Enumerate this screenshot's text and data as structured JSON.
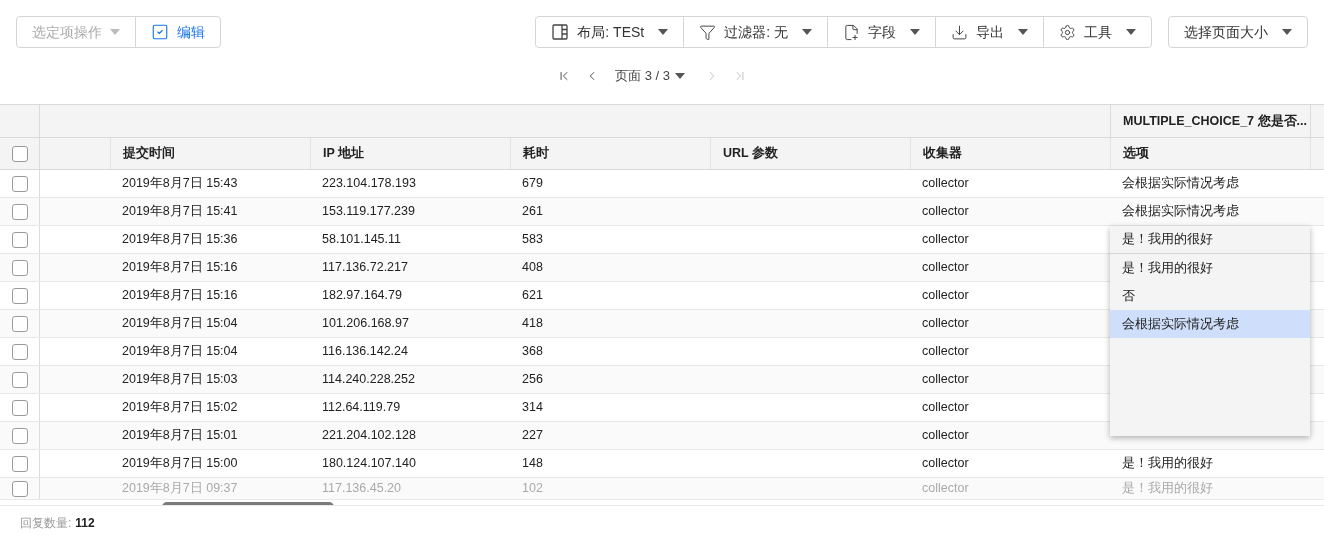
{
  "toolbar": {
    "left": [
      {
        "kind": "actions",
        "label": "选定项操作",
        "disabled": true
      },
      {
        "kind": "edit",
        "label": "编辑",
        "disabled": false
      }
    ],
    "right": [
      {
        "kind": "layout",
        "label": "布局: TESt"
      },
      {
        "kind": "filter",
        "label": "过滤器: 无"
      },
      {
        "kind": "field",
        "label": "字段"
      },
      {
        "kind": "export",
        "label": "导出"
      },
      {
        "kind": "tools",
        "label": "工具"
      }
    ],
    "page_size": {
      "label": "选择页面大小"
    }
  },
  "pagination": {
    "label": "页面 3 / 3",
    "buttons": [
      {
        "kind": "first",
        "disabled": false
      },
      {
        "kind": "prev",
        "disabled": false
      },
      {
        "kind": "next",
        "disabled": true
      },
      {
        "kind": "last",
        "disabled": true
      }
    ]
  },
  "table": {
    "select_all": {
      "checked": false
    },
    "group_header": "MULTIPLE_CHOICE_7 您是否...",
    "columns": [
      "提交时间",
      "IP 地址",
      "耗时",
      "URL 参数",
      "收集器",
      "选项"
    ],
    "rows": [
      {
        "checked": false,
        "dimmed": false,
        "time": "2019年8月7日 15:43",
        "ip": "223.104.178.193",
        "duration": "679",
        "collector": "collector",
        "choice": "会根据实际情况考虑"
      },
      {
        "checked": false,
        "dimmed": false,
        "time": "2019年8月7日 15:41",
        "ip": "153.119.177.239",
        "duration": "261",
        "collector": "collector",
        "choice": "会根据实际情况考虑"
      },
      {
        "checked": false,
        "dimmed": false,
        "time": "2019年8月7日 15:36",
        "ip": "58.101.145.11",
        "duration": "583",
        "collector": "collector"
      },
      {
        "checked": false,
        "dimmed": false,
        "time": "2019年8月7日 15:16",
        "ip": "117.136.72.217",
        "duration": "408",
        "collector": "collector"
      },
      {
        "checked": false,
        "dimmed": false,
        "time": "2019年8月7日 15:16",
        "ip": "182.97.164.79",
        "duration": "621",
        "collector": "collector"
      },
      {
        "checked": false,
        "dimmed": false,
        "time": "2019年8月7日 15:04",
        "ip": "101.206.168.97",
        "duration": "418",
        "collector": "collector"
      },
      {
        "checked": false,
        "dimmed": false,
        "time": "2019年8月7日 15:04",
        "ip": "116.136.142.24",
        "duration": "368",
        "collector": "collector"
      },
      {
        "checked": false,
        "dimmed": false,
        "time": "2019年8月7日 15:03",
        "ip": "114.240.228.252",
        "duration": "256",
        "collector": "collector"
      },
      {
        "checked": false,
        "dimmed": false,
        "time": "2019年8月7日 15:02",
        "ip": "112.64.119.79",
        "duration": "314",
        "collector": "collector"
      },
      {
        "checked": false,
        "dimmed": false,
        "time": "2019年8月7日 15:01",
        "ip": "221.204.102.128",
        "duration": "227",
        "collector": "collector"
      },
      {
        "checked": false,
        "dimmed": false,
        "time": "2019年8月7日 15:00",
        "ip": "180.124.107.140",
        "duration": "148",
        "collector": "collector",
        "choice": "是！我用的很好"
      },
      {
        "checked": false,
        "dimmed": true,
        "time": "2019年8月7日 09:37",
        "ip": "117.136.45.20",
        "duration": "102",
        "collector": "collector",
        "choice": "是！我用的很好"
      }
    ]
  },
  "dropdown": {
    "value": "是！我用的很好",
    "options": [
      {
        "label": "是！我用的很好",
        "highlighted": false
      },
      {
        "label": "否",
        "highlighted": false
      },
      {
        "label": "会根据实际情况考虑",
        "highlighted": true
      }
    ]
  },
  "footer": {
    "label": "回复数量:",
    "value": "112"
  }
}
